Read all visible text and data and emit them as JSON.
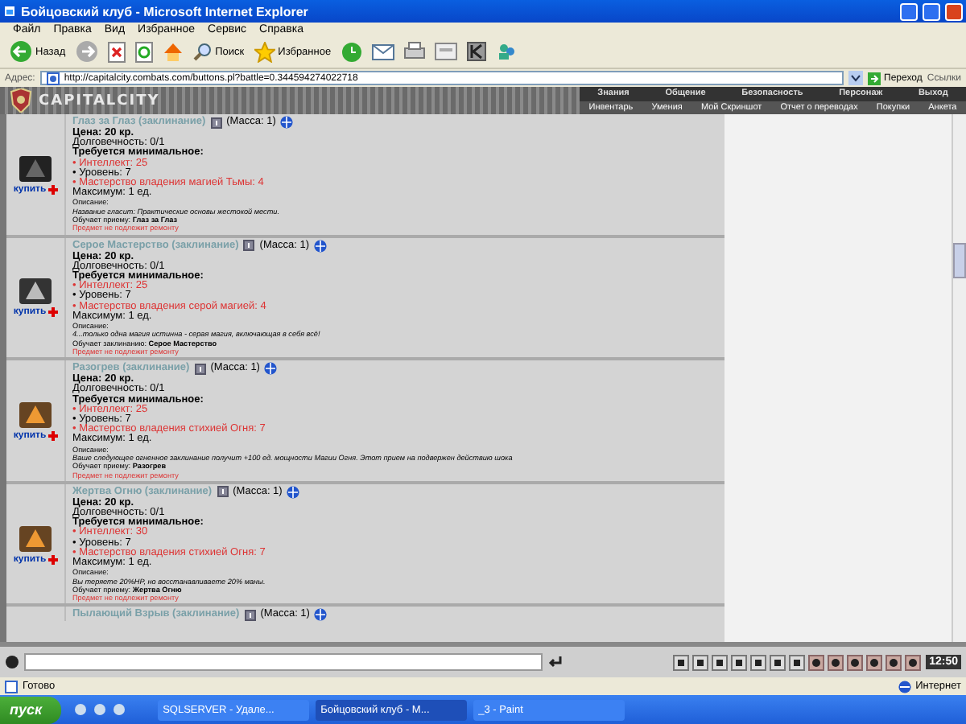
{
  "window": {
    "title": "Бойцовский клуб - Microsoft Internet Explorer"
  },
  "menu": [
    "Файл",
    "Правка",
    "Вид",
    "Избранное",
    "Сервис",
    "Справка"
  ],
  "toolbar": {
    "back": "Назад",
    "search": "Поиск",
    "favorites": "Избранное"
  },
  "address": {
    "label": "Адрес:",
    "url": "http://capitalcity.combats.com/buttons.pl?battle=0.344594274022718",
    "go": "Переход",
    "links": "Ссылки"
  },
  "game_header": {
    "logo": "CAPITALCITY",
    "top_nav": [
      "Знания",
      "Общение",
      "Безопасность",
      "Персонаж",
      "Выход"
    ],
    "sub_nav": [
      "Инвентарь",
      "Умения",
      "Мой Скриншот",
      "Отчет о переводах",
      "Покупки",
      "Анкета"
    ]
  },
  "items": [
    {
      "title": "Глаз за Глаз (заклинание)",
      "mass": "(Масса: 1)",
      "buy": "купить",
      "price": "Цена: 20 кр.",
      "durability": "Долговечность: 0/1",
      "req_heading": "Требуется минимальное:",
      "requirements": [
        {
          "text": "• Интеллект: 25",
          "met": false
        },
        {
          "text": "• Уровень: 7",
          "met": true
        },
        {
          "text": "• Мастерство владения магией Тьмы: 4",
          "met": false
        }
      ],
      "max": "Максимум: 1 ед.",
      "desc_label": "Описание:",
      "description": "Название гласит: Практические основы жестокой мести.",
      "teaches": "Обучает приему: **Глаз за Глаз**",
      "note": "Предмет не подлежит ремонту",
      "kind": "dark"
    },
    {
      "title": "Серое Мастерство (заклинание)",
      "mass": "(Масса: 1)",
      "buy": "купить",
      "price": "Цена: 20 кр.",
      "durability": "Долговечность: 0/1",
      "req_heading": "Требуется минимальное:",
      "requirements": [
        {
          "text": "• Интеллект: 25",
          "met": false
        },
        {
          "text": "• Уровень: 7",
          "met": true
        },
        {
          "text": "• Мастерство владения серой магией: 4",
          "met": false
        }
      ],
      "max": "Максимум: 1 ед.",
      "desc_label": "Описание:",
      "description": "4...только одна магия истинна - серая магия, включающая в себя всё!",
      "teaches": "Обучает заклинанию: **Серое Мастерство**",
      "note": "Предмет не подлежит ремонту",
      "kind": "gray"
    },
    {
      "title": "Разогрев (заклинание)",
      "mass": "(Масса: 1)",
      "buy": "купить",
      "price": "Цена: 20 кр.",
      "durability": "Долговечность: 0/1",
      "req_heading": "Требуется минимальное:",
      "requirements": [
        {
          "text": "• Интеллект: 25",
          "met": false
        },
        {
          "text": "• Уровень: 7",
          "met": true
        },
        {
          "text": "• Мастерство владения стихией Огня: 7",
          "met": false
        }
      ],
      "max": "Максимум: 1 ед.",
      "desc_label": "Описание:",
      "description": "Ваше следующее огненное заклинание получит +100 ед. мощности Магии Огня. Этот прием на подвержен действию шока",
      "teaches": "Обучает приему: **Разогрев**",
      "note": "Предмет не подлежит ремонту",
      "kind": "fire"
    },
    {
      "title": "Жертва Огню (заклинание)",
      "mass": "(Масса: 1)",
      "buy": "купить",
      "price": "Цена: 20 кр.",
      "durability": "Долговечность: 0/1",
      "req_heading": "Требуется минимальное:",
      "requirements": [
        {
          "text": "• Интеллект: 30",
          "met": false
        },
        {
          "text": "• Уровень: 7",
          "met": true
        },
        {
          "text": "• Мастерство владения стихией Огня: 7",
          "met": false
        }
      ],
      "max": "Максимум: 1 ед.",
      "desc_label": "Описание:",
      "description": "Вы теряете 20%HP, но восстанавливаете 20% маны.",
      "teaches": "Обучает приему: **Жертва Огню**",
      "note": "Предмет не подлежит ремонту",
      "kind": "fire"
    }
  ],
  "partial_item": {
    "title": "Пылающий Взрыв (заклинание)",
    "mass": "(Масса: 1)"
  },
  "chat": {
    "clock": "12:50"
  },
  "status_bar": {
    "status": "Готово",
    "zone": "Интернет"
  },
  "taskbar": {
    "start": "пуск",
    "tasks": [
      {
        "label": "SQLSERVER - Удале...",
        "selected": false
      },
      {
        "label": "Бойцовский клуб - M...",
        "selected": true
      },
      {
        "label": "_3 - Paint",
        "selected": false
      }
    ]
  }
}
